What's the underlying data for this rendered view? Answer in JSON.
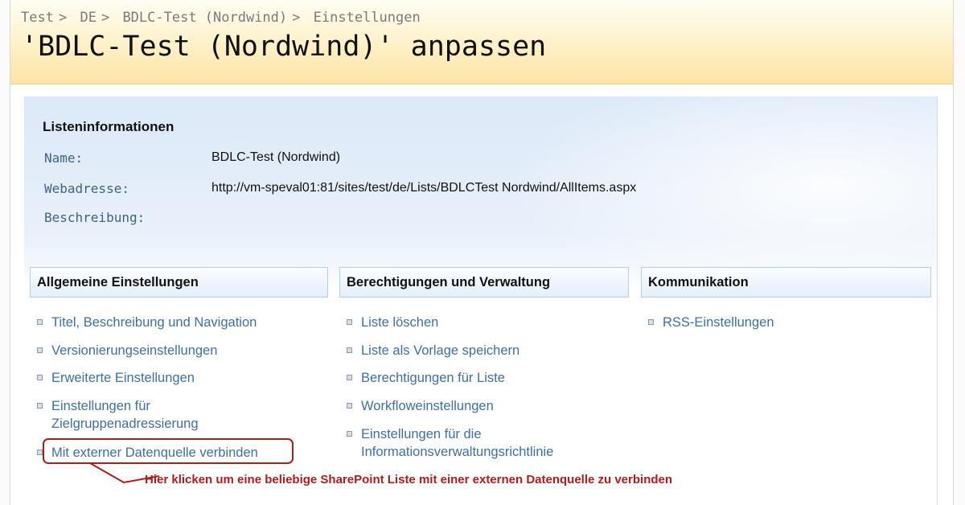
{
  "breadcrumb": {
    "items": [
      "Test",
      "DE",
      "BDLC-Test (Nordwind)",
      "Einstellungen"
    ],
    "separator": ">"
  },
  "page_title": "'BDLC-Test (Nordwind)' anpassen",
  "list_info": {
    "heading": "Listeninformationen",
    "name_label": "Name:",
    "name_value": "BDLC-Test (Nordwind)",
    "webaddress_label": "Webadresse:",
    "webaddress_value": "http://vm-speval01:81/sites/test/de/Lists/BDLCTest Nordwind/AllItems.aspx",
    "description_label": "Beschreibung:"
  },
  "sections": {
    "general": {
      "title": "Allgemeine Einstellungen",
      "links": [
        "Titel, Beschreibung und Navigation",
        "Versionierungseinstellungen",
        "Erweiterte Einstellungen",
        "Einstellungen für",
        "Zielgruppenadressierung",
        "Mit externer Datenquelle verbinden"
      ]
    },
    "permissions": {
      "title": "Berechtigungen und Verwaltung",
      "links": [
        "Liste löschen",
        "Liste als Vorlage speichern",
        "Berechtigungen für Liste",
        "Workfloweinstellungen",
        "Einstellungen für die",
        "Informationsverwaltungsrichtlinie"
      ]
    },
    "communication": {
      "title": "Kommunikation",
      "links": [
        "RSS-Einstellungen"
      ]
    }
  },
  "callout": {
    "text": "Hier klicken um eine beliebige SharePoint Liste mit einer externen Datenquelle zu verbinden",
    "color": "#b01c1c"
  },
  "colors": {
    "link": "#3e6fa5",
    "label": "#3e6485",
    "header_bg": "#fbe4a3",
    "section_border": "#b6cde6"
  }
}
